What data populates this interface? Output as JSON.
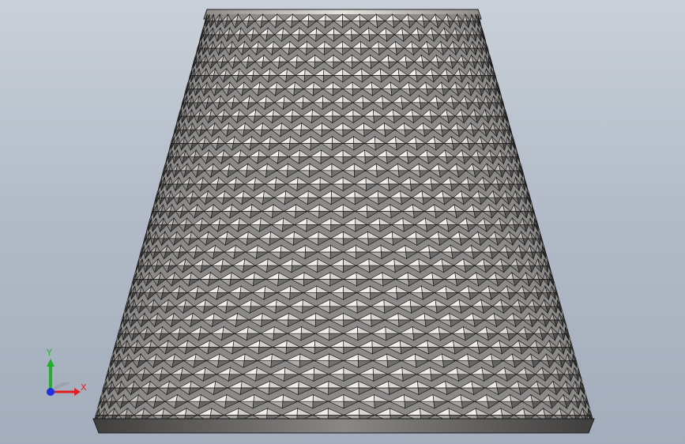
{
  "viewport": {
    "background_top": "#c9d0d9",
    "background_bottom": "#a3adbb"
  },
  "model": {
    "name": "knurled-frustum",
    "body_color": "#8c8a88",
    "facet_light": "#f2eeea",
    "facet_mid": "#bdb9b5",
    "facet_dark": "#5f5d5b",
    "edge_color": "#1c1c1c",
    "top_cap_color": "#d8d4cf",
    "bottom_band_color": "#6e6c6a",
    "rows": 30,
    "columns": 25
  },
  "triad": {
    "y_label": "Y",
    "x_label": "X",
    "y_color": "#22b02a",
    "x_color": "#e02020",
    "z_color": "#2030e0",
    "icon": "coordinate-triad-icon"
  }
}
